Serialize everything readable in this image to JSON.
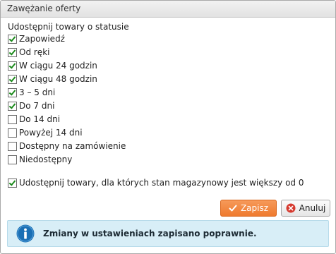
{
  "dialog": {
    "title": "Zawężanie oferty"
  },
  "section": {
    "label": "Udostępnij towary o statusie"
  },
  "statuses": [
    {
      "label": "Zapowiedź",
      "checked": true
    },
    {
      "label": "Od ręki",
      "checked": true
    },
    {
      "label": "W ciągu 24 godzin",
      "checked": true
    },
    {
      "label": "W ciągu 48 godzin",
      "checked": true
    },
    {
      "label": "3 – 5 dni",
      "checked": true
    },
    {
      "label": "Do 7 dni",
      "checked": true
    },
    {
      "label": "Do 14 dni",
      "checked": false
    },
    {
      "label": "Powyżej 14 dni",
      "checked": false
    },
    {
      "label": "Dostępny na zamówienie",
      "checked": false
    },
    {
      "label": "Niedostępny",
      "checked": false
    }
  ],
  "stock_option": {
    "label": "Udostępnij towary, dla których stan magazynowy jest większy od 0",
    "checked": true
  },
  "buttons": {
    "save_label": "Zapisz",
    "save_icon": "checkmark-icon",
    "cancel_label": "Anuluj",
    "cancel_icon": "close-icon"
  },
  "message": {
    "text": "Zmiany w ustawieniach zapisano poprawnie.",
    "icon": "info-icon"
  },
  "colors": {
    "save_button": "#ef7a2e",
    "message_background": "#d8eef7",
    "checkmark": "#1b8a1b",
    "info_icon": "#1a6fb5"
  }
}
